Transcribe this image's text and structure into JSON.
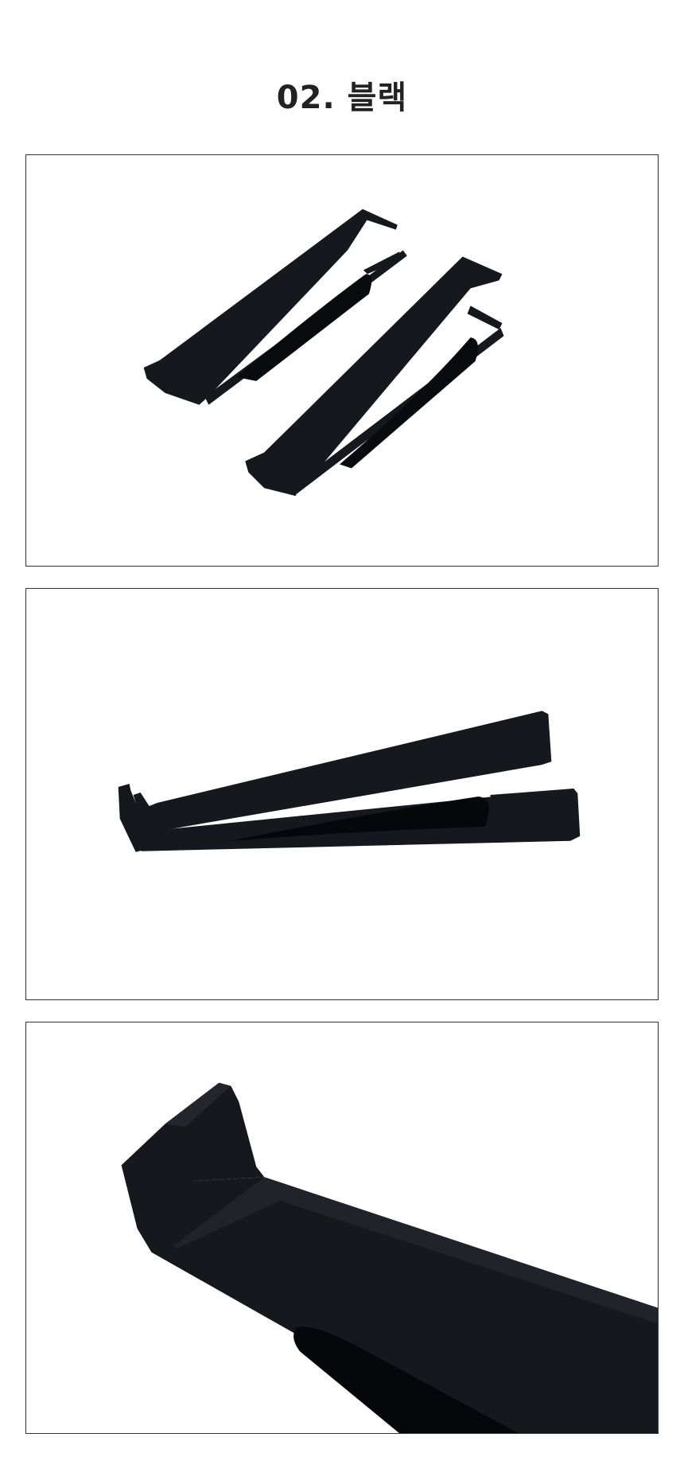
{
  "heading": {
    "title": "02. 블랙"
  },
  "product_color": "#16181d",
  "photos": [
    {
      "subject": "two-black-stands-top-view"
    },
    {
      "subject": "black-stand-side-view"
    },
    {
      "subject": "black-stand-closeup"
    }
  ]
}
